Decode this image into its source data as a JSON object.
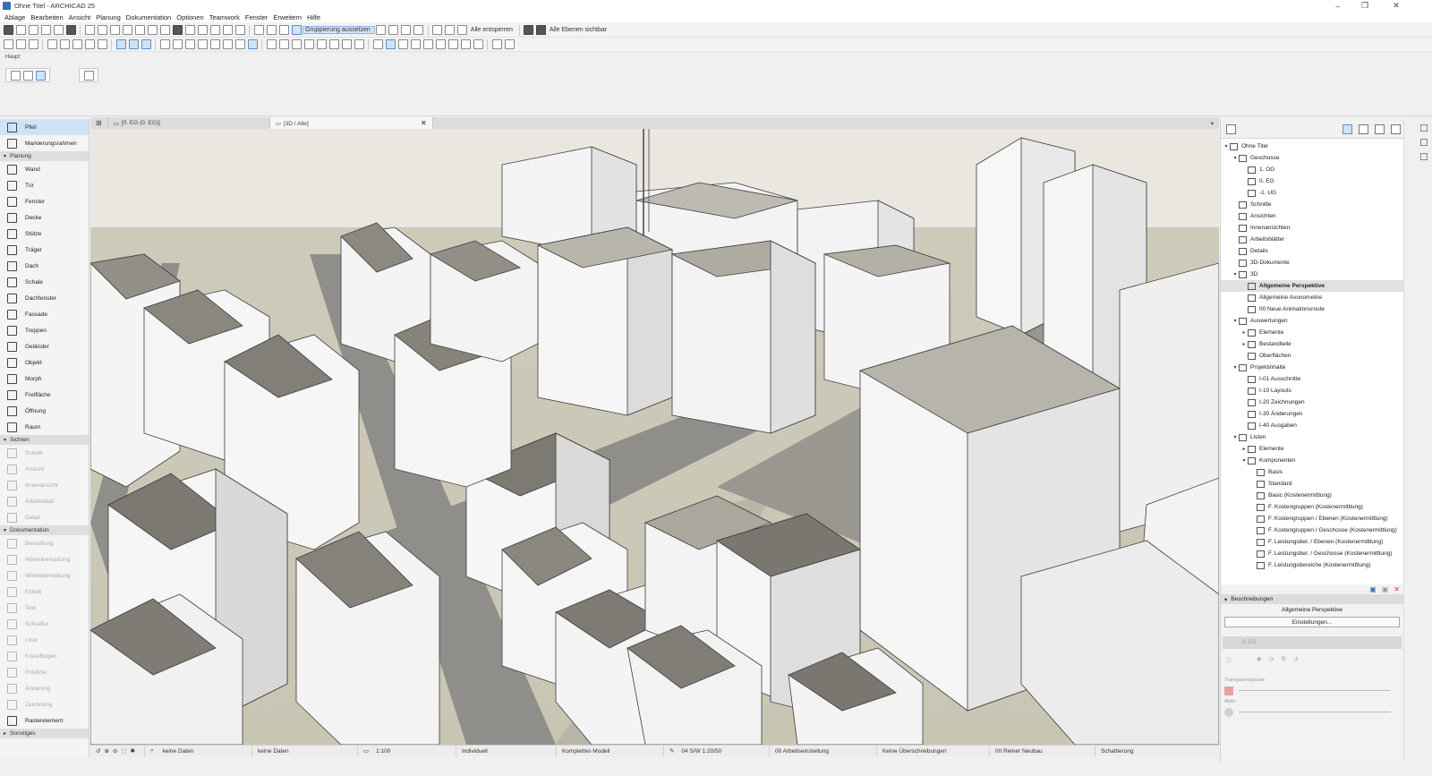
{
  "window": {
    "title": "Ohne Titel - ARCHICAD 25"
  },
  "menu": [
    "Ablage",
    "Bearbeiten",
    "Ansicht",
    "Planung",
    "Dokumentation",
    "Optionen",
    "Teamwork",
    "Fenster",
    "Erweitern",
    "Hilfe"
  ],
  "toolbar1": {
    "grouping_label": "Gruppierung aussetzen",
    "unlock_all": "Alle entsperren",
    "all_layers_visible": "Alle Ebenen sichtbar"
  },
  "infobox": {
    "label": "Haupt:"
  },
  "toolbox": {
    "top": [
      {
        "label": "Pfeil",
        "icon": "arrow-icon"
      },
      {
        "label": "Markierungsrahmen",
        "icon": "marquee-icon"
      }
    ],
    "sections": [
      {
        "name": "Planung",
        "items": [
          "Wand",
          "Tür",
          "Fenster",
          "Decke",
          "Stütze",
          "Träger",
          "Dach",
          "Schale",
          "Dachfenster",
          "Fassade",
          "Treppen",
          "Geländer",
          "Objekt",
          "Morph",
          "Freifläche",
          "Öffnung",
          "Raum"
        ]
      },
      {
        "name": "Sichten",
        "items": [
          "Schnitt",
          "Ansicht",
          "Innenansicht",
          "Arbeitsblatt",
          "Detail"
        ]
      },
      {
        "name": "Dokumentation",
        "items": [
          "Bemaßung",
          "Höhenbemaßung",
          "Winkelbemaßung",
          "Etikett",
          "Text",
          "Schraffur",
          "Linie",
          "Kreis/Bogen",
          "Polylinie",
          "Änderung",
          "Zeichnung",
          "Rasterelement"
        ]
      },
      {
        "name": "Sonstiges",
        "items": []
      }
    ]
  },
  "tabs": [
    {
      "label": "[0. EG (0. EG)]"
    },
    {
      "label": "[3D / Alle]"
    }
  ],
  "navigator": {
    "tree": [
      {
        "label": "Ohne Titel",
        "level": 0,
        "exp": "▾"
      },
      {
        "label": "Geschosse",
        "level": 1,
        "exp": "▾"
      },
      {
        "label": "1. OG",
        "level": 2,
        "exp": ""
      },
      {
        "label": "0. EG",
        "level": 2,
        "exp": ""
      },
      {
        "label": "-1. UG",
        "level": 2,
        "exp": ""
      },
      {
        "label": "Schnitte",
        "level": 1,
        "exp": ""
      },
      {
        "label": "Ansichten",
        "level": 1,
        "exp": ""
      },
      {
        "label": "Innenansichten",
        "level": 1,
        "exp": ""
      },
      {
        "label": "Arbeitsblätter",
        "level": 1,
        "exp": ""
      },
      {
        "label": "Details",
        "level": 1,
        "exp": ""
      },
      {
        "label": "3D-Dokumente",
        "level": 1,
        "exp": ""
      },
      {
        "label": "3D",
        "level": 1,
        "exp": "▾"
      },
      {
        "label": "Allgemeine Perspektive",
        "level": 2,
        "exp": "",
        "sel": true
      },
      {
        "label": "Allgemeine Axonometrie",
        "level": 2,
        "exp": ""
      },
      {
        "label": "00 Neue Animationsroute",
        "level": 2,
        "exp": ""
      },
      {
        "label": "Auswertungen",
        "level": 1,
        "exp": "▾"
      },
      {
        "label": "Elemente",
        "level": 2,
        "exp": "▸"
      },
      {
        "label": "Bestandteile",
        "level": 2,
        "exp": "▸"
      },
      {
        "label": "Oberflächen",
        "level": 2,
        "exp": ""
      },
      {
        "label": "Projektinhalte",
        "level": 1,
        "exp": "▾"
      },
      {
        "label": "I-01 Ausschnitte",
        "level": 2,
        "exp": ""
      },
      {
        "label": "I-10 Layouts",
        "level": 2,
        "exp": ""
      },
      {
        "label": "I-20 Zeichnungen",
        "level": 2,
        "exp": ""
      },
      {
        "label": "I-30 Änderungen",
        "level": 2,
        "exp": ""
      },
      {
        "label": "I-40 Ausgaben",
        "level": 2,
        "exp": ""
      },
      {
        "label": "Listen",
        "level": 1,
        "exp": "▾"
      },
      {
        "label": "Elemente",
        "level": 2,
        "exp": "▸"
      },
      {
        "label": "Komponenten",
        "level": 2,
        "exp": "▾"
      },
      {
        "label": "Basis",
        "level": 3,
        "exp": ""
      },
      {
        "label": "Standard",
        "level": 3,
        "exp": ""
      },
      {
        "label": "Basic (Kostenermittlung)",
        "level": 3,
        "exp": ""
      },
      {
        "label": "F. Kostengruppen (Kostenermittlung)",
        "level": 3,
        "exp": ""
      },
      {
        "label": "F. Kostengruppen / Ebenen (Kostenermittlung)",
        "level": 3,
        "exp": ""
      },
      {
        "label": "F. Kostengruppen / Geschosse (Kostenermittlung)",
        "level": 3,
        "exp": ""
      },
      {
        "label": "F. Leistungsber. / Ebenen (Kostenermittlung)",
        "level": 3,
        "exp": ""
      },
      {
        "label": "F. Leistungsber. / Geschosse (Kostenermittlung)",
        "level": 3,
        "exp": ""
      },
      {
        "label": "F. Leistungsbereiche (Kostenermittlung)",
        "level": 3,
        "exp": ""
      }
    ]
  },
  "properties": {
    "header": "Beschreibungen",
    "view_name": "Allgemeine Perspektive",
    "settings_button": "Einstellungen...",
    "story": "0. EG",
    "transparency_label": "Transparentpause:",
    "active_label": "Aktiv:"
  },
  "statusbar": [
    "keine Daten",
    "keine Daten",
    "1:100",
    "Individuell",
    "Komplettes Modell",
    "04 S/W 1:20/50",
    "00 Arbeitseinstellung",
    "Keine Überschreibungen",
    "00 Reiner Neubau",
    "Schattierung"
  ]
}
